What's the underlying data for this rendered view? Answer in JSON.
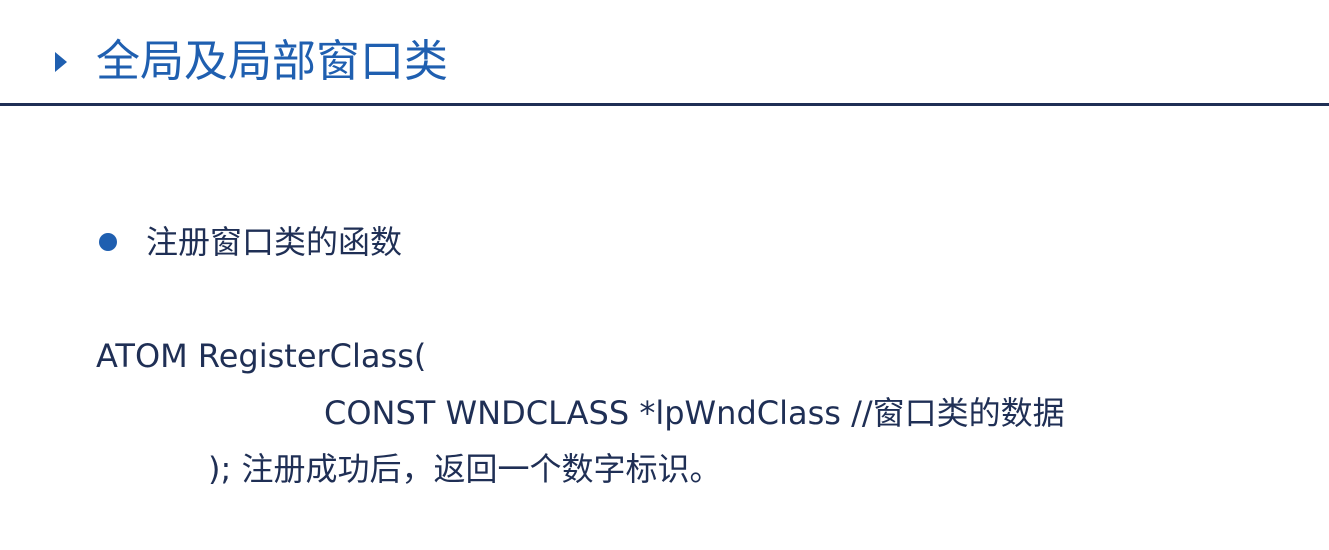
{
  "slide": {
    "title": "全局及局部窗口类",
    "bullet": "注册窗口类的函数",
    "code": {
      "line1": "ATOM RegisterClass(",
      "line2": "CONST WNDCLASS *lpWndClass //窗口类的数据",
      "line3": "); 注册成功后，返回一个数字标识。"
    }
  },
  "colors": {
    "accent": "#1f5fb0",
    "text": "#1f2f55",
    "rule": "#1f2f55",
    "background": "#ffffff"
  },
  "icons": {
    "title_marker": "triangle-right-icon",
    "bullet_marker": "bullet-dot-icon"
  }
}
